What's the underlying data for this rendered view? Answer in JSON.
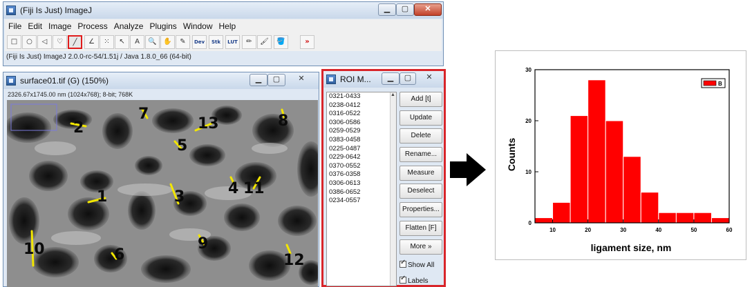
{
  "imagej": {
    "title": "(Fiji Is Just) ImageJ",
    "menu": [
      "File",
      "Edit",
      "Image",
      "Process",
      "Analyze",
      "Plugins",
      "Window",
      "Help"
    ],
    "status": "(Fiji Is Just) ImageJ 2.0.0-rc-54/1.51j / Java 1.8.0_66 (64-bit)",
    "tools": [
      {
        "name": "rectangle-tool",
        "glyph": "□"
      },
      {
        "name": "oval-tool",
        "glyph": "○"
      },
      {
        "name": "polygon-tool",
        "glyph": "◁"
      },
      {
        "name": "freehand-tool",
        "glyph": "♡"
      },
      {
        "name": "line-tool",
        "glyph": "╱",
        "selected": true
      },
      {
        "name": "angle-tool",
        "glyph": "∠"
      },
      {
        "name": "point-tool",
        "glyph": "⁙"
      },
      {
        "name": "wand-tool",
        "glyph": "↖"
      },
      {
        "name": "text-tool",
        "glyph": "A"
      },
      {
        "name": "magnifier-tool",
        "glyph": "🔍"
      },
      {
        "name": "hand-tool",
        "glyph": "✋"
      },
      {
        "name": "color-picker-tool",
        "glyph": "✎"
      },
      {
        "name": "dev-tool",
        "glyph": "Dev"
      },
      {
        "name": "stk-tool",
        "glyph": "Stk"
      },
      {
        "name": "lut-tool",
        "glyph": "LUT"
      },
      {
        "name": "pencil-tool",
        "glyph": "✏"
      },
      {
        "name": "brush-tool",
        "glyph": "🖌"
      },
      {
        "name": "flood-fill-tool",
        "glyph": "🪣"
      },
      {
        "name": "more-tools",
        "glyph": "»"
      }
    ]
  },
  "image_window": {
    "title": "surface01.tif (G) (150%)",
    "info": "2326.67x1745.00  nm (1024x768); 8-bit; 768K",
    "roi_labels": [
      "2",
      "7",
      "13",
      "8",
      "5",
      "1",
      "3",
      "4",
      "11",
      "10",
      "6",
      "9",
      "12"
    ]
  },
  "roi_manager": {
    "title": "ROI M...",
    "items": [
      "0321-0433",
      "0238-0412",
      "0316-0522",
      "0306-0586",
      "0259-0529",
      "0383-0458",
      "0225-0487",
      "0229-0642",
      "0370-0552",
      "0376-0358",
      "0306-0613",
      "0386-0652",
      "0234-0557"
    ],
    "buttons": [
      "Add [t]",
      "Update",
      "Delete",
      "Rename...",
      "Measure",
      "Deselect",
      "Properties...",
      "Flatten [F]",
      "More »"
    ],
    "show_all": "Show All",
    "labels": "Labels"
  },
  "chart_data": {
    "type": "bar",
    "xlabel": "ligament size, nm",
    "ylabel": "Counts",
    "legend": "B",
    "legend_position": "top-right",
    "bar_color": "#ff0000",
    "bin_width": 5,
    "bins": [
      5,
      10,
      15,
      20,
      25,
      30,
      35,
      40,
      45,
      50,
      55
    ],
    "values": [
      1,
      4,
      21,
      28,
      20,
      13,
      6,
      2,
      2,
      2,
      1
    ],
    "xlim": [
      5,
      60
    ],
    "ylim": [
      0,
      30
    ],
    "xticks": [
      10,
      20,
      30,
      40,
      50,
      60
    ],
    "yticks": [
      0,
      10,
      20,
      30
    ]
  }
}
